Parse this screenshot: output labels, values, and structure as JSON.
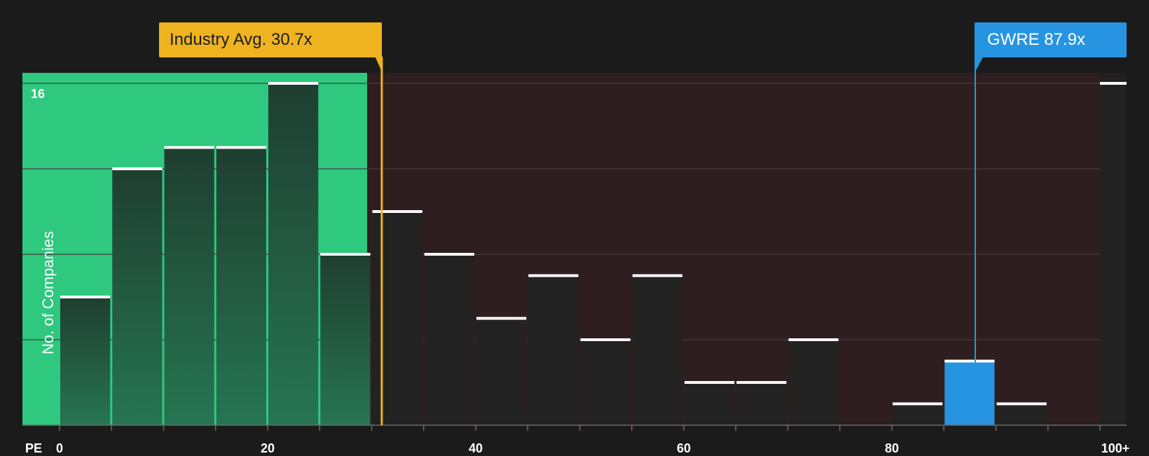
{
  "chart_data": {
    "type": "bar",
    "xlabel": "PE",
    "ylabel": "No. of Companies",
    "x_ticks": [
      "0",
      "20",
      "40",
      "60",
      "80",
      "100+"
    ],
    "y_tick_labels": [
      "16"
    ],
    "ylim": [
      0,
      16
    ],
    "bin_width": 5,
    "bins": [
      {
        "x0": 0,
        "x1": 5,
        "value": 6
      },
      {
        "x0": 5,
        "x1": 10,
        "value": 12
      },
      {
        "x0": 10,
        "x1": 15,
        "value": 13
      },
      {
        "x0": 15,
        "x1": 20,
        "value": 13
      },
      {
        "x0": 20,
        "x1": 25,
        "value": 16
      },
      {
        "x0": 25,
        "x1": 30,
        "value": 8
      },
      {
        "x0": 30,
        "x1": 35,
        "value": 10
      },
      {
        "x0": 35,
        "x1": 40,
        "value": 8
      },
      {
        "x0": 40,
        "x1": 45,
        "value": 5
      },
      {
        "x0": 45,
        "x1": 50,
        "value": 7
      },
      {
        "x0": 50,
        "x1": 55,
        "value": 4
      },
      {
        "x0": 55,
        "x1": 60,
        "value": 7
      },
      {
        "x0": 60,
        "x1": 65,
        "value": 2
      },
      {
        "x0": 65,
        "x1": 70,
        "value": 2
      },
      {
        "x0": 70,
        "x1": 75,
        "value": 4
      },
      {
        "x0": 75,
        "x1": 80,
        "value": 0
      },
      {
        "x0": 80,
        "x1": 85,
        "value": 1
      },
      {
        "x0": 85,
        "x1": 90,
        "value": 3,
        "highlight": true
      },
      {
        "x0": 90,
        "x1": 95,
        "value": 1
      },
      {
        "x0": 100,
        "x1": 105,
        "value": 16
      }
    ],
    "industry_avg": {
      "label": "Industry Avg. 30.7x",
      "value": 30.7
    },
    "company": {
      "label": "GWRE 87.9x",
      "value": 87.9
    },
    "fair_region_max": 29.5,
    "colors": {
      "fair_region": "#2ec87e",
      "over_region": "#2f1e1f",
      "bar_dark": "#222222",
      "bar_green_top": "#1f3e30",
      "bar_green_bottom": "#267552",
      "highlight": "#2694e1",
      "industry": "#eeb31f",
      "cap": "#ffffff",
      "grid": "#4a3a3b",
      "axis": "#6a6a6a"
    }
  }
}
